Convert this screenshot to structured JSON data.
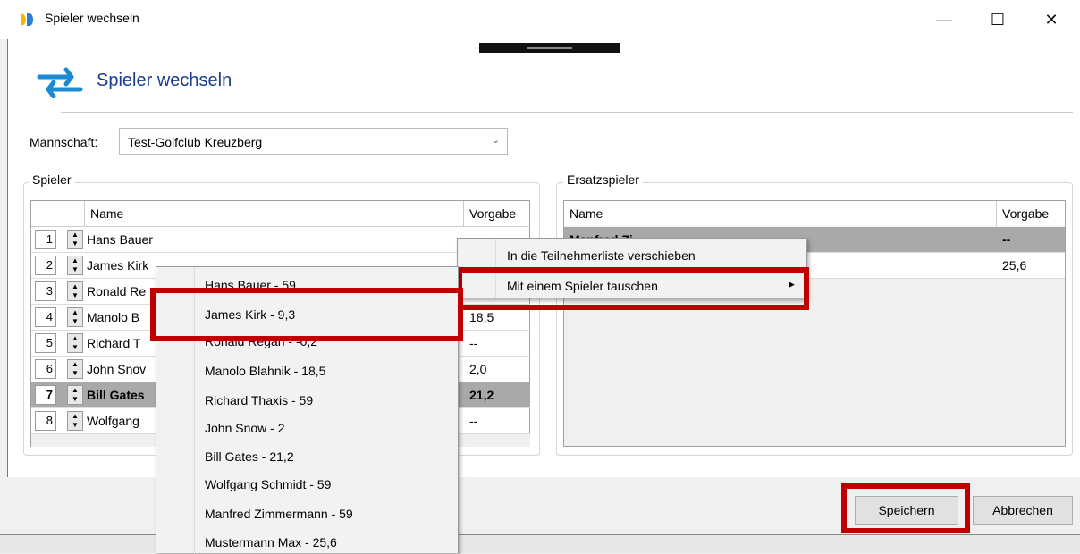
{
  "window": {
    "title": "Spieler wechseln",
    "minimize": "—",
    "maximize": "☐",
    "close": "✕"
  },
  "header": {
    "title": "Spieler wechseln",
    "icon": "swap-arrows-icon"
  },
  "team": {
    "label": "Mannschaft:",
    "value": "Test-Golfclub Kreuzberg"
  },
  "players": {
    "group_title": "Spieler",
    "col_name": "Name",
    "col_vorgabe": "Vorgabe",
    "rows": [
      {
        "num": "1",
        "name": "Hans Bauer",
        "vorgabe": ""
      },
      {
        "num": "2",
        "name": "James Kirk",
        "vorgabe": ""
      },
      {
        "num": "3",
        "name": "Ronald Re",
        "vorgabe": ""
      },
      {
        "num": "4",
        "name": "Manolo B",
        "vorgabe": "18,5"
      },
      {
        "num": "5",
        "name": "Richard T",
        "vorgabe": "--"
      },
      {
        "num": "6",
        "name": "John Snov",
        "vorgabe": "2,0"
      },
      {
        "num": "7",
        "name": "Bill Gates",
        "vorgabe": "21,2"
      },
      {
        "num": "8",
        "name": "Wolfgang",
        "vorgabe": "--"
      }
    ]
  },
  "substitutes": {
    "group_title": "Ersatzspieler",
    "col_name": "Name",
    "col_vorgabe": "Vorgabe",
    "rows": [
      {
        "name": "Manfred Zi",
        "vorgabe": "--"
      },
      {
        "name": "",
        "vorgabe": "25,6"
      }
    ]
  },
  "context_menu": {
    "items": [
      "In die Teilnehmerliste verschieben",
      "Mit einem Spieler tauschen"
    ]
  },
  "submenu": {
    "items": [
      "Hans Bauer - 59",
      "James Kirk - 9,3",
      "Ronald Regan - -0,2",
      "Manolo Blahnik - 18,5",
      "Richard Thaxis - 59",
      "John Snow - 2",
      "Bill Gates - 21,2",
      "Wolfgang Schmidt - 59",
      "Manfred Zimmermann - 59",
      "Mustermann Max - 25,6"
    ]
  },
  "buttons": {
    "save": "Speichern",
    "cancel": "Abbrechen"
  },
  "colors": {
    "highlight": "#c00000",
    "accent": "#1a3c8c",
    "selected_row": "#a9a9a9"
  }
}
